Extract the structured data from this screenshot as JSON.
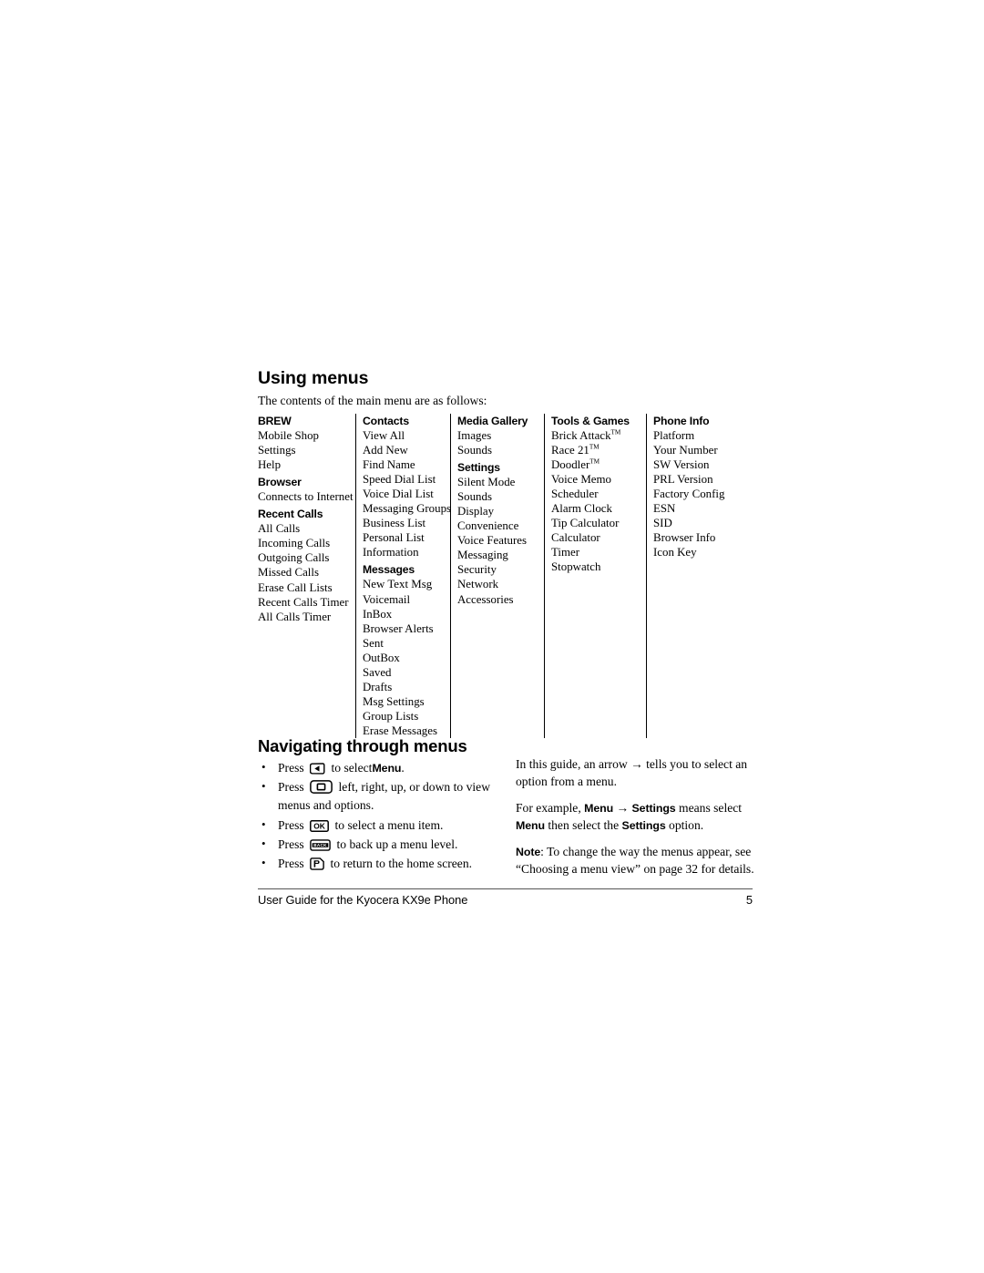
{
  "page": {
    "section_title": "Using menus",
    "intro": "The contents of the main menu are as follows:",
    "nav_title": "Navigating through menus"
  },
  "menu_table": {
    "columns": [
      {
        "name": "brew",
        "blocks": [
          {
            "heading": "BREW",
            "items": [
              "Mobile Shop",
              "Settings",
              "Help"
            ]
          },
          {
            "heading": "Browser",
            "items": [
              "Connects to Internet"
            ]
          },
          {
            "heading": "Recent Calls",
            "items": [
              "All Calls",
              "Incoming Calls",
              "Outgoing Calls",
              "Missed Calls",
              "Erase Call Lists",
              "Recent Calls Timer",
              "All Calls Timer"
            ]
          }
        ]
      },
      {
        "name": "contacts",
        "blocks": [
          {
            "heading": "Contacts",
            "items": [
              "View All",
              "Add New",
              "Find Name",
              "Speed Dial List",
              "Voice Dial List",
              "Messaging Groups",
              "Business List",
              "Personal List",
              "Information"
            ]
          },
          {
            "heading": "Messages",
            "items": [
              "New Text Msg",
              "Voicemail",
              "InBox",
              "Browser Alerts",
              "Sent",
              "OutBox",
              "Saved",
              "Drafts",
              "Msg Settings",
              "Group Lists",
              "Erase Messages"
            ]
          }
        ]
      },
      {
        "name": "media-gallery",
        "blocks": [
          {
            "heading": "Media Gallery",
            "items": [
              "Images",
              "Sounds"
            ]
          },
          {
            "heading": "Settings",
            "items": [
              "Silent Mode",
              "Sounds",
              "Display",
              "Convenience",
              "Voice Features",
              "Messaging",
              "Security",
              "Network",
              "Accessories"
            ]
          }
        ]
      },
      {
        "name": "tools-and-games",
        "blocks": [
          {
            "heading": "Tools & Games",
            "items": [
              "Brick Attack™",
              "Race 21™",
              "Doodler™",
              "Voice Memo",
              "Scheduler",
              "Alarm Clock",
              "Tip Calculator",
              "Calculator",
              "Timer",
              "Stopwatch"
            ]
          }
        ]
      },
      {
        "name": "phone-info",
        "blocks": [
          {
            "heading": "Phone Info",
            "items": [
              "Platform",
              "Your Number",
              "SW Version",
              "PRL Version",
              "Factory Config",
              "ESN",
              "SID",
              "Browser Info",
              "Icon Key"
            ]
          }
        ]
      }
    ]
  },
  "key_instructions": [
    {
      "icon": "left-softkey-icon",
      "before": "Press",
      "after_1": "to select",
      "bold": "Menu",
      "after_2": "."
    },
    {
      "icon": "navigation-key-icon",
      "before": "Press",
      "after_1": "left, right, up, or down to view menus and options.",
      "bold": "",
      "after_2": ""
    },
    {
      "icon": "ok-key-icon",
      "before": "Press",
      "after_1": "to select a menu item.",
      "bold": "",
      "after_2": ""
    },
    {
      "icon": "back-key-icon",
      "before": "Press",
      "after_1": "to back up a menu level.",
      "bold": "",
      "after_2": ""
    },
    {
      "icon": "end-key-icon",
      "before": "Press",
      "after_1": "to return to the home screen.",
      "bold": "",
      "after_2": ""
    }
  ],
  "key_icon_labels": {
    "ok": "OK",
    "back": "BACK"
  },
  "guide_notes": {
    "para1_a": "In this guide, an arrow",
    "para1_arrow": "→",
    "para1_b": "tells you to select an option from a menu.",
    "para2_a": "For example,",
    "para2_menu": "Menu",
    "para2_arrow": "→",
    "para2_settings": "Settings",
    "para2_b": "means select",
    "para2_menu2": "Menu",
    "para2_c": "then select the",
    "para2_settings2": "Settings",
    "para2_d": "option.",
    "note_label": "Note",
    "note_text": ": To change the way the menus appear, see “Choosing a menu view” on page 32 for details."
  },
  "footer": {
    "text": "User Guide for the Kyocera KX9e Phone",
    "page_number": "5"
  }
}
